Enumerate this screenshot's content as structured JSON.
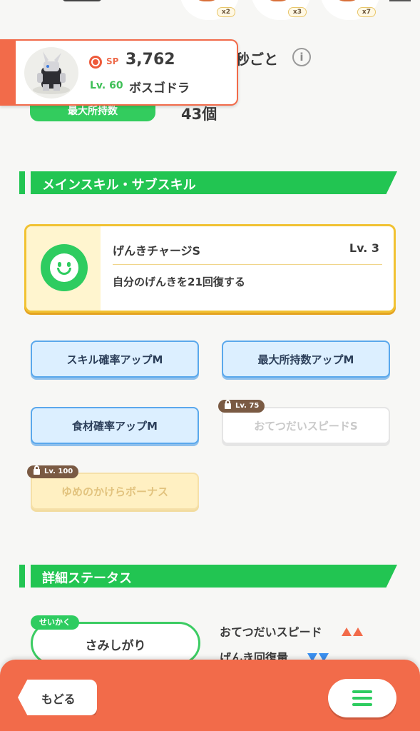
{
  "top_ingredients": [
    {
      "icon": "ingredient-icon",
      "count": "x2"
    },
    {
      "icon": "ingredient-icon",
      "count": "x3"
    },
    {
      "icon": "ingredient-icon",
      "count": "x7"
    }
  ],
  "pokemon_card": {
    "sp_label": "SP",
    "sp_value": "3,762",
    "level": "Lv. 60",
    "name": "ボスゴドラ"
  },
  "help_interval": {
    "suffix_text": "秒ごと",
    "info_icon": "i"
  },
  "max_carry": {
    "label": "最大所持数",
    "value": "43個"
  },
  "sections": {
    "skills": "メインスキル・サブスキル",
    "details": "詳細ステータス"
  },
  "main_skill": {
    "name": "げんきチャージS",
    "level": "Lv. 3",
    "description": "自分のげんきを21回復する"
  },
  "sub_skills": [
    {
      "label": "スキル確率アップM",
      "state": "unlocked"
    },
    {
      "label": "最大所持数アップM",
      "state": "unlocked"
    },
    {
      "label": "食材確率アップM",
      "state": "unlocked"
    },
    {
      "label": "おてつだいスピードS",
      "state": "locked",
      "unlock_level": "Lv. 75"
    },
    {
      "label": "ゆめのかけらボーナス",
      "state": "locked",
      "unlock_level": "Lv. 100"
    }
  ],
  "nature": {
    "tag": "せいかく",
    "value": "さみしがり"
  },
  "nature_effects": [
    {
      "label": "おてつだいスピード",
      "direction": "up"
    },
    {
      "label": "げんき回復量",
      "direction": "down"
    }
  ],
  "bottom_bar": {
    "back_label": "もどる",
    "menu_icon": "hamburger-menu-icon"
  },
  "colors": {
    "accent_orange": "#f26b4a",
    "accent_green": "#22c552",
    "skill_gold": "#f1c232",
    "subskill_blue": "#5aa8ec"
  }
}
